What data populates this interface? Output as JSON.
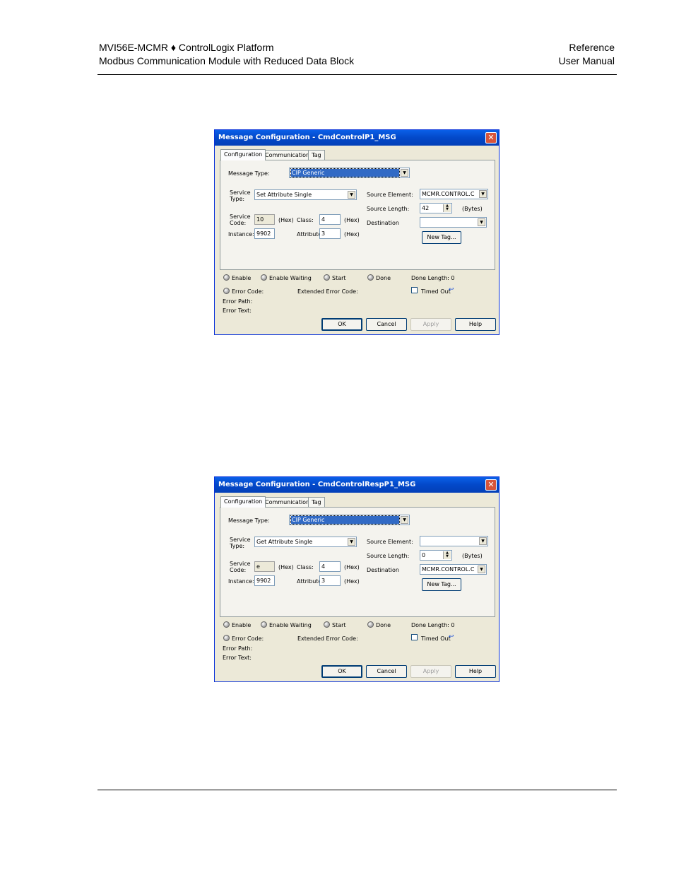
{
  "header": {
    "left_line1": "MVI56E-MCMR ♦ ControlLogix Platform",
    "left_line2": "Modbus Communication Module with Reduced Data Block",
    "right_line1": "Reference",
    "right_line2": "User Manual"
  },
  "dialogs": [
    {
      "title": "Message Configuration - CmdControlP1_MSG",
      "tabs": [
        "Configuration",
        "Communication",
        "Tag"
      ],
      "message_type_label": "Message Type:",
      "message_type_value": "CIP Generic",
      "service_type_label": "Service Type:",
      "service_type_value": "Set Attribute Single",
      "service_code_label": "Service Code:",
      "service_code_value": "10",
      "hex1": "(Hex)",
      "class_label": "Class:",
      "class_value": "4",
      "hex2": "(Hex)",
      "instance_label": "Instance:",
      "instance_value": "9902",
      "attribute_label": "Attribute:",
      "attribute_value": "3",
      "hex3": "(Hex)",
      "source_element_label": "Source Element:",
      "source_element_value": "MCMR.CONTROL.C",
      "source_length_label": "Source Length:",
      "source_length_value": "42",
      "bytes_label": "(Bytes)",
      "destination_label": "Destination",
      "destination_value": "",
      "new_tag_label": "New Tag...",
      "status": {
        "enable": "Enable",
        "enable_waiting": "Enable Waiting",
        "start": "Start",
        "done": "Done",
        "done_length": "Done Length: 0",
        "error_code": "Error Code:",
        "extended_error_code": "Extended Error Code:",
        "timed_out": "Timed Out",
        "error_path": "Error Path:",
        "error_text": "Error Text:"
      },
      "buttons": {
        "ok": "OK",
        "cancel": "Cancel",
        "apply": "Apply",
        "help": "Help"
      }
    },
    {
      "title": "Message Configuration - CmdControlRespP1_MSG",
      "tabs": [
        "Configuration",
        "Communication",
        "Tag"
      ],
      "message_type_label": "Message Type:",
      "message_type_value": "CIP Generic",
      "service_type_label": "Service Type:",
      "service_type_value": "Get Attribute Single",
      "service_code_label": "Service Code:",
      "service_code_value": "e",
      "hex1": "(Hex)",
      "class_label": "Class:",
      "class_value": "4",
      "hex2": "(Hex)",
      "instance_label": "Instance:",
      "instance_value": "9902",
      "attribute_label": "Attribute:",
      "attribute_value": "3",
      "hex3": "(Hex)",
      "source_element_label": "Source Element:",
      "source_element_value": "",
      "source_length_label": "Source Length:",
      "source_length_value": "0",
      "bytes_label": "(Bytes)",
      "destination_label": "Destination",
      "destination_value": "MCMR.CONTROL.C",
      "new_tag_label": "New Tag...",
      "status": {
        "enable": "Enable",
        "enable_waiting": "Enable Waiting",
        "start": "Start",
        "done": "Done",
        "done_length": "Done Length: 0",
        "error_code": "Error Code:",
        "extended_error_code": "Extended Error Code:",
        "timed_out": "Timed Out",
        "error_path": "Error Path:",
        "error_text": "Error Text:"
      },
      "buttons": {
        "ok": "OK",
        "cancel": "Cancel",
        "apply": "Apply",
        "help": "Help"
      }
    }
  ]
}
